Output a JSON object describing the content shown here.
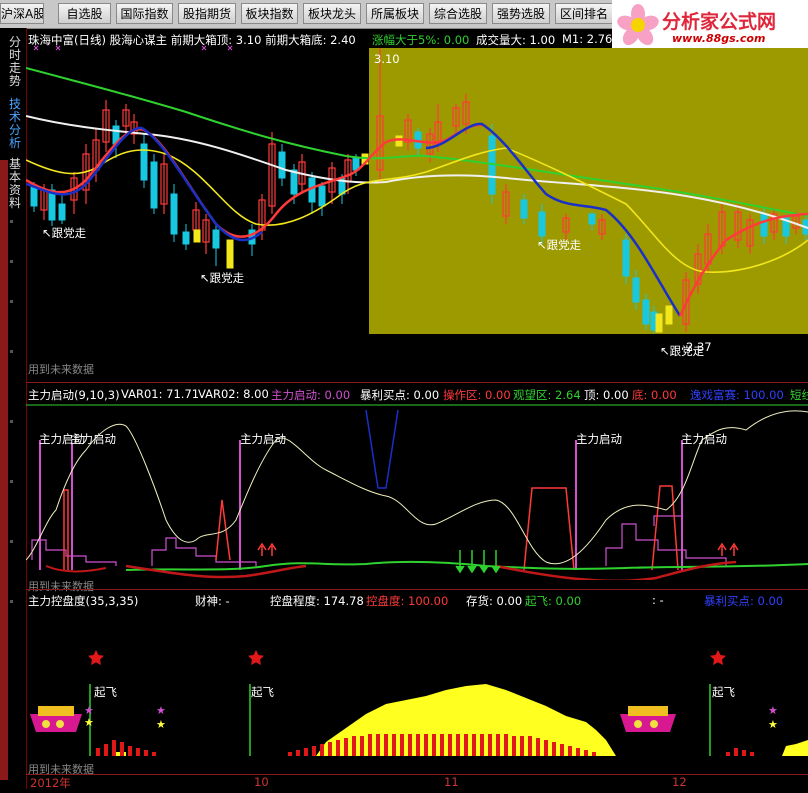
{
  "toolbar": {
    "buttons": [
      "沪深A股",
      "自选股",
      "国际指数",
      "股指期货",
      "板块指数",
      "板块龙头",
      "所属板块",
      "综合选股",
      "强势选股",
      "区间排名"
    ]
  },
  "logo": {
    "title": "分析家公式网",
    "url": "www.88gs.com"
  },
  "sidebar": {
    "tabs": [
      "分时走势",
      "技术分析",
      "基本资料"
    ]
  },
  "panel1": {
    "title": "珠海中富(日线) 股海心谋主 前期大箱顶: 3.10 前期大箱底: 2.40",
    "stats": {
      "up5": "涨幅大于5%: 0.00",
      "vol": "成交量大: 1.00",
      "m1": "M1: 2.76"
    },
    "marks": {
      "high": "3.10",
      "low": "2.37"
    },
    "annotations": [
      "跟党走",
      "跟党走",
      "跟党走",
      "跟党走"
    ],
    "future": "用到未来数据"
  },
  "panel2": {
    "title": "主力启动(9,10,3)",
    "var01": "VAR01: 71.71",
    "var02": "VAR02: 8.00",
    "zhuli": "主力启动: 0.00",
    "baoli": "暴利买点: 0.00",
    "caozuo": "操作区: 0.00",
    "guanwang": "观望区: 2.64",
    "ding": "顶: 0.00",
    "di": "底: 0.00",
    "extra1": "逸戏富赛: 100.00",
    "extra2": "短线",
    "labels": [
      "主力启动",
      "主力启动",
      "主力启动",
      "主力启动",
      "主力启动"
    ],
    "future": "用到未来数据"
  },
  "panel3": {
    "title": "主力控盘度(35,3,35)",
    "caishen": "财神: -",
    "kongpan": "控盘程度: 174.78",
    "kongpandu": "控盘度: 100.00",
    "cunhuo": "存货: 0.00",
    "qifei": "起飞: 0.00",
    "dash": ": -",
    "baoli": "暴利买点: 0.00",
    "qifei_labels": [
      "起飞",
      "起飞",
      "起飞"
    ],
    "future": "用到未来数据"
  },
  "dates": {
    "year": "2012年",
    "m10": "10",
    "m11": "11",
    "m12": "12"
  },
  "colors": {
    "accent_yellow": "#9d9a00",
    "up": "#ff3a3a",
    "down": "#18c8e0",
    "magenta": "#d050d0"
  }
}
